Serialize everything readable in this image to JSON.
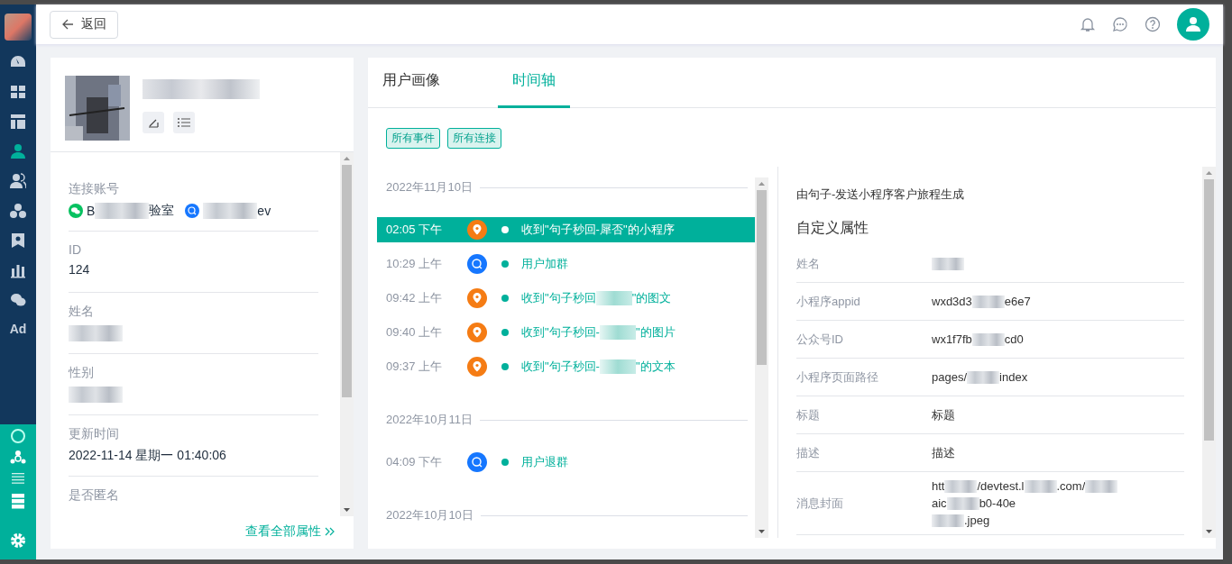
{
  "sidebar": {
    "ad_label": "Ad"
  },
  "header": {
    "back_button": "返回"
  },
  "profile": {
    "fields": [
      {
        "label": "连接账号",
        "kind": "accounts",
        "accounts": [
          {
            "kind": "wechat",
            "segments": [
              {
                "kind": "text",
                "text": "B"
              },
              {
                "kind": "blur"
              },
              {
                "kind": "text",
                "text": "验室"
              }
            ]
          },
          {
            "kind": "wecom",
            "segments": [
              {
                "kind": "blur"
              },
              {
                "kind": "text",
                "text": "ev"
              }
            ]
          }
        ]
      },
      {
        "label": "ID",
        "kind": "value",
        "segments": [
          {
            "kind": "text",
            "text": "124"
          }
        ]
      },
      {
        "label": "姓名",
        "kind": "value",
        "segments": [
          {
            "kind": "blur"
          }
        ]
      },
      {
        "label": "性别",
        "kind": "value",
        "segments": [
          {
            "kind": "blur"
          }
        ]
      },
      {
        "label": "更新时间",
        "kind": "value",
        "segments": [
          {
            "kind": "text",
            "text": "2022-11-14 星期一 01:40:06"
          }
        ]
      },
      {
        "label": "是否匿名",
        "kind": "label"
      }
    ],
    "view_all_link": "查看全部属性"
  },
  "tabs": [
    {
      "label": "用户画像",
      "selected": false
    },
    {
      "label": "时间轴",
      "selected": true
    }
  ],
  "filters": [
    {
      "label": "所有事件"
    },
    {
      "label": "所有连接"
    }
  ],
  "timeline": [
    {
      "date": "2022年11月10日",
      "events": [
        {
          "time": "02:05 下午",
          "kind": "miniprogram",
          "selected": true,
          "segments": [
            {
              "kind": "text",
              "text": "收到\"句子秒回-犀否\"的小程序"
            }
          ]
        },
        {
          "time": "10:29 上午",
          "kind": "group",
          "selected": false,
          "segments": [
            {
              "kind": "text",
              "text": "用户加群"
            }
          ]
        },
        {
          "time": "09:42 上午",
          "kind": "miniprogram",
          "selected": false,
          "segments": [
            {
              "kind": "text",
              "text": "收到\"句子秒回"
            },
            {
              "kind": "blur"
            },
            {
              "kind": "text",
              "text": "\"的图文"
            }
          ]
        },
        {
          "time": "09:40 上午",
          "kind": "miniprogram",
          "selected": false,
          "segments": [
            {
              "kind": "text",
              "text": "收到\"句子秒回-"
            },
            {
              "kind": "blur"
            },
            {
              "kind": "text",
              "text": "\"的图片"
            }
          ]
        },
        {
          "time": "09:37 上午",
          "kind": "miniprogram",
          "selected": false,
          "segments": [
            {
              "kind": "text",
              "text": "收到\"句子秒回-"
            },
            {
              "kind": "blur"
            },
            {
              "kind": "text",
              "text": "\"的文本"
            }
          ]
        }
      ]
    },
    {
      "date": "2022年10月11日",
      "events": [
        {
          "time": "04:09 下午",
          "kind": "group",
          "selected": false,
          "segments": [
            {
              "kind": "text",
              "text": "用户退群"
            }
          ]
        }
      ]
    },
    {
      "date": "2022年10月10日"
    }
  ],
  "detail": {
    "source": "由句子-发送小程序客户旅程生成",
    "section_title": "自定义属性",
    "rows": [
      {
        "label": "姓名",
        "lines": [
          [
            {
              "kind": "blur"
            }
          ]
        ]
      },
      {
        "label": "小程序appid",
        "lines": [
          [
            {
              "kind": "text",
              "text": "wxd3d3"
            },
            {
              "kind": "blur"
            },
            {
              "kind": "text",
              "text": "e6e7"
            }
          ]
        ]
      },
      {
        "label": "公众号ID",
        "lines": [
          [
            {
              "kind": "text",
              "text": "wx1f7fb"
            },
            {
              "kind": "blur"
            },
            {
              "kind": "text",
              "text": "cd0"
            }
          ]
        ]
      },
      {
        "label": "小程序页面路径",
        "lines": [
          [
            {
              "kind": "text",
              "text": "pages/"
            },
            {
              "kind": "blur"
            },
            {
              "kind": "text",
              "text": "index"
            }
          ]
        ]
      },
      {
        "label": "标题",
        "lines": [
          [
            {
              "kind": "text",
              "text": "标题"
            }
          ]
        ]
      },
      {
        "label": "描述",
        "lines": [
          [
            {
              "kind": "text",
              "text": "描述"
            }
          ]
        ]
      },
      {
        "label": "消息封面",
        "lines": [
          [
            {
              "kind": "text",
              "text": "htt"
            },
            {
              "kind": "blur"
            },
            {
              "kind": "text",
              "text": "/devtest.l"
            },
            {
              "kind": "blur"
            },
            {
              "kind": "text",
              "text": ".com/"
            },
            {
              "kind": "blur"
            }
          ],
          [
            {
              "kind": "text",
              "text": "aic"
            },
            {
              "kind": "blur"
            },
            {
              "kind": "text",
              "text": "b0-40e"
            }
          ],
          [
            {
              "kind": "blur"
            },
            {
              "kind": "text",
              "text": ".jpeg"
            }
          ]
        ]
      }
    ]
  }
}
